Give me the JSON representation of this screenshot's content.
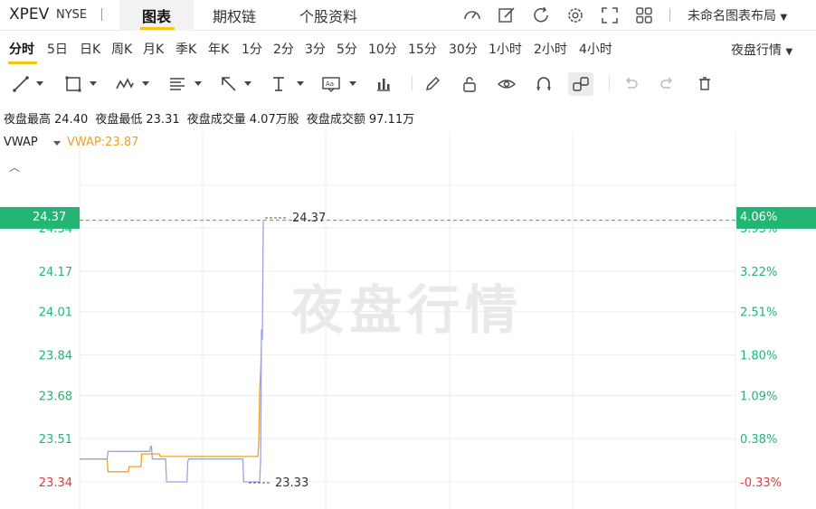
{
  "header": {
    "ticker": "XPEV",
    "exchange": "NYSE",
    "tabs": [
      {
        "label": "图表",
        "active": true
      },
      {
        "label": "期权链",
        "active": false
      },
      {
        "label": "个股资料",
        "active": false
      }
    ],
    "icons": [
      "speedometer-icon",
      "edit-icon",
      "refresh-icon",
      "settings-icon",
      "fullscreen-icon",
      "grid-icon"
    ],
    "layout_label": "未命名图表布局"
  },
  "intervals": {
    "items": [
      "分时",
      "5日",
      "日K",
      "周K",
      "月K",
      "季K",
      "年K",
      "1分",
      "2分",
      "3分",
      "5分",
      "10分",
      "15分",
      "30分",
      "1小时",
      "2小时",
      "4小时"
    ],
    "active": "分时",
    "session_label": "夜盘行情"
  },
  "drawing_tools": [
    "trend-line-icon",
    "rectangle-icon",
    "pattern-icon",
    "fib-icon",
    "arrow-icon",
    "text-cursor-icon",
    "annotation-icon",
    "bar-chart-icon",
    "pencil-icon",
    "lock-icon",
    "eye-icon",
    "magnet-icon",
    "link-icon",
    "undo-icon",
    "redo-icon",
    "trash-icon"
  ],
  "stats": {
    "high_label": "夜盘最高",
    "high": "24.40",
    "low_label": "夜盘最低",
    "low": "23.31",
    "vol_label": "夜盘成交量",
    "vol": "4.07万股",
    "amt_label": "夜盘成交额",
    "amt": "97.11万"
  },
  "indicator": {
    "name": "VWAP",
    "value_text": "VWAP:23.87"
  },
  "watermark": "夜盘行情",
  "colors": {
    "up": "#22b573",
    "down": "#e03a3a",
    "vwap": "#f0a020",
    "price": "#9aa3e6",
    "accent": "#f5c518"
  },
  "chart_data": {
    "type": "line",
    "y_ticks_left": [
      24.34,
      24.17,
      24.01,
      23.84,
      23.68,
      23.51,
      23.34
    ],
    "y_ticks_left_text": [
      "24.34",
      "24.17",
      "24.01",
      "23.84",
      "23.68",
      "23.51",
      "23.34"
    ],
    "y_ticks_right_text": [
      "3.93%",
      "3.22%",
      "2.51%",
      "1.80%",
      "1.09%",
      "0.38%",
      "-0.33%"
    ],
    "current_price": "24.37",
    "current_pct": "4.06%",
    "high_marker": "24.37",
    "low_marker": "23.33",
    "ylim": [
      23.31,
      24.45
    ],
    "series": [
      {
        "name": "VWAP",
        "values": [
          23.43,
          23.43,
          23.43,
          23.43,
          23.43,
          23.43,
          23.43,
          23.43,
          23.43,
          23.43,
          23.43,
          23.43,
          23.43,
          23.43,
          23.43,
          23.43,
          23.43,
          23.43,
          23.43,
          23.43,
          23.43,
          23.43,
          23.43,
          23.43,
          23.43,
          23.43,
          23.43,
          23.43,
          23.43,
          23.43,
          23.43,
          23.43,
          23.38,
          23.38,
          23.38,
          23.38,
          23.38,
          23.38,
          23.38,
          23.38,
          23.38,
          23.38,
          23.38,
          23.38,
          23.38,
          23.38,
          23.38,
          23.38,
          23.38,
          23.38,
          23.38,
          23.38,
          23.38,
          23.38,
          23.38,
          23.38,
          23.4,
          23.4,
          23.4,
          23.4,
          23.4,
          23.4,
          23.4,
          23.4,
          23.4,
          23.4,
          23.4,
          23.4,
          23.4,
          23.4,
          23.45,
          23.45,
          23.45,
          23.45,
          23.45,
          23.45,
          23.45,
          23.45,
          23.45,
          23.45,
          23.45,
          23.45,
          23.45,
          23.45,
          23.45,
          23.45,
          23.45,
          23.45,
          23.45,
          23.45,
          23.45,
          23.44,
          23.44,
          23.44,
          23.44,
          23.44,
          23.44,
          23.44,
          23.44,
          23.44,
          23.44,
          23.44,
          23.44,
          23.44,
          23.44,
          23.44,
          23.44,
          23.44,
          23.44,
          23.44,
          23.44,
          23.44,
          23.44,
          23.44,
          23.44,
          23.44,
          23.44,
          23.44,
          23.44,
          23.44,
          23.44,
          23.44,
          23.44,
          23.44,
          23.44,
          23.44,
          23.44,
          23.44,
          23.44,
          23.44,
          23.44,
          23.44,
          23.44,
          23.44,
          23.44,
          23.44,
          23.44,
          23.44,
          23.44,
          23.44,
          23.44,
          23.44,
          23.44,
          23.44,
          23.44,
          23.44,
          23.44,
          23.44,
          23.44,
          23.44,
          23.44,
          23.44,
          23.44,
          23.44,
          23.44,
          23.44,
          23.44,
          23.44,
          23.44,
          23.44,
          23.44,
          23.44,
          23.44,
          23.44,
          23.44,
          23.44,
          23.44,
          23.44,
          23.44,
          23.44,
          23.44,
          23.44,
          23.44,
          23.44,
          23.44,
          23.44,
          23.44,
          23.44,
          23.44,
          23.44,
          23.44,
          23.44,
          23.44,
          23.44,
          23.44,
          23.44,
          23.44,
          23.44,
          23.44,
          23.44,
          23.44,
          23.44,
          23.44,
          23.44,
          23.44,
          23.44,
          23.44,
          23.44,
          23.44,
          23.44,
          23.44,
          23.44,
          23.5,
          23.7,
          23.78,
          23.87
        ]
      },
      {
        "name": "价格",
        "values": [
          23.43,
          23.43,
          23.43,
          23.43,
          23.43,
          23.43,
          23.43,
          23.43,
          23.43,
          23.43,
          23.43,
          23.43,
          23.43,
          23.43,
          23.43,
          23.43,
          23.43,
          23.43,
          23.43,
          23.43,
          23.43,
          23.43,
          23.43,
          23.43,
          23.43,
          23.43,
          23.43,
          23.43,
          23.43,
          23.43,
          23.43,
          23.43,
          23.46,
          23.46,
          23.46,
          23.46,
          23.46,
          23.46,
          23.46,
          23.46,
          23.46,
          23.46,
          23.46,
          23.46,
          23.46,
          23.46,
          23.46,
          23.46,
          23.46,
          23.46,
          23.46,
          23.46,
          23.46,
          23.46,
          23.46,
          23.46,
          23.46,
          23.46,
          23.46,
          23.46,
          23.46,
          23.46,
          23.46,
          23.46,
          23.46,
          23.46,
          23.46,
          23.46,
          23.46,
          23.46,
          23.46,
          23.46,
          23.46,
          23.46,
          23.46,
          23.46,
          23.46,
          23.46,
          23.46,
          23.46,
          23.48,
          23.48,
          23.43,
          23.43,
          23.43,
          23.43,
          23.43,
          23.43,
          23.43,
          23.43,
          23.43,
          23.43,
          23.43,
          23.43,
          23.43,
          23.43,
          23.43,
          23.43,
          23.34,
          23.34,
          23.34,
          23.34,
          23.34,
          23.34,
          23.34,
          23.34,
          23.34,
          23.34,
          23.34,
          23.34,
          23.34,
          23.34,
          23.34,
          23.34,
          23.34,
          23.34,
          23.34,
          23.34,
          23.34,
          23.34,
          23.34,
          23.34,
          23.42,
          23.43,
          23.43,
          23.43,
          23.43,
          23.43,
          23.43,
          23.43,
          23.43,
          23.43,
          23.43,
          23.43,
          23.43,
          23.43,
          23.43,
          23.43,
          23.43,
          23.43,
          23.43,
          23.43,
          23.43,
          23.43,
          23.43,
          23.43,
          23.43,
          23.43,
          23.43,
          23.43,
          23.43,
          23.43,
          23.43,
          23.43,
          23.43,
          23.43,
          23.43,
          23.43,
          23.43,
          23.43,
          23.43,
          23.43,
          23.43,
          23.43,
          23.43,
          23.43,
          23.43,
          23.43,
          23.43,
          23.43,
          23.43,
          23.43,
          23.43,
          23.43,
          23.43,
          23.43,
          23.43,
          23.43,
          23.43,
          23.43,
          23.43,
          23.43,
          23.43,
          23.43,
          23.43,
          23.34,
          23.34,
          23.34,
          23.34,
          23.34,
          23.34,
          23.34,
          23.34,
          23.34,
          23.34,
          23.34,
          23.34,
          23.34,
          23.34,
          23.34,
          23.34,
          23.34,
          23.34,
          23.34,
          23.43,
          23.94,
          23.9,
          24.37
        ]
      }
    ]
  }
}
